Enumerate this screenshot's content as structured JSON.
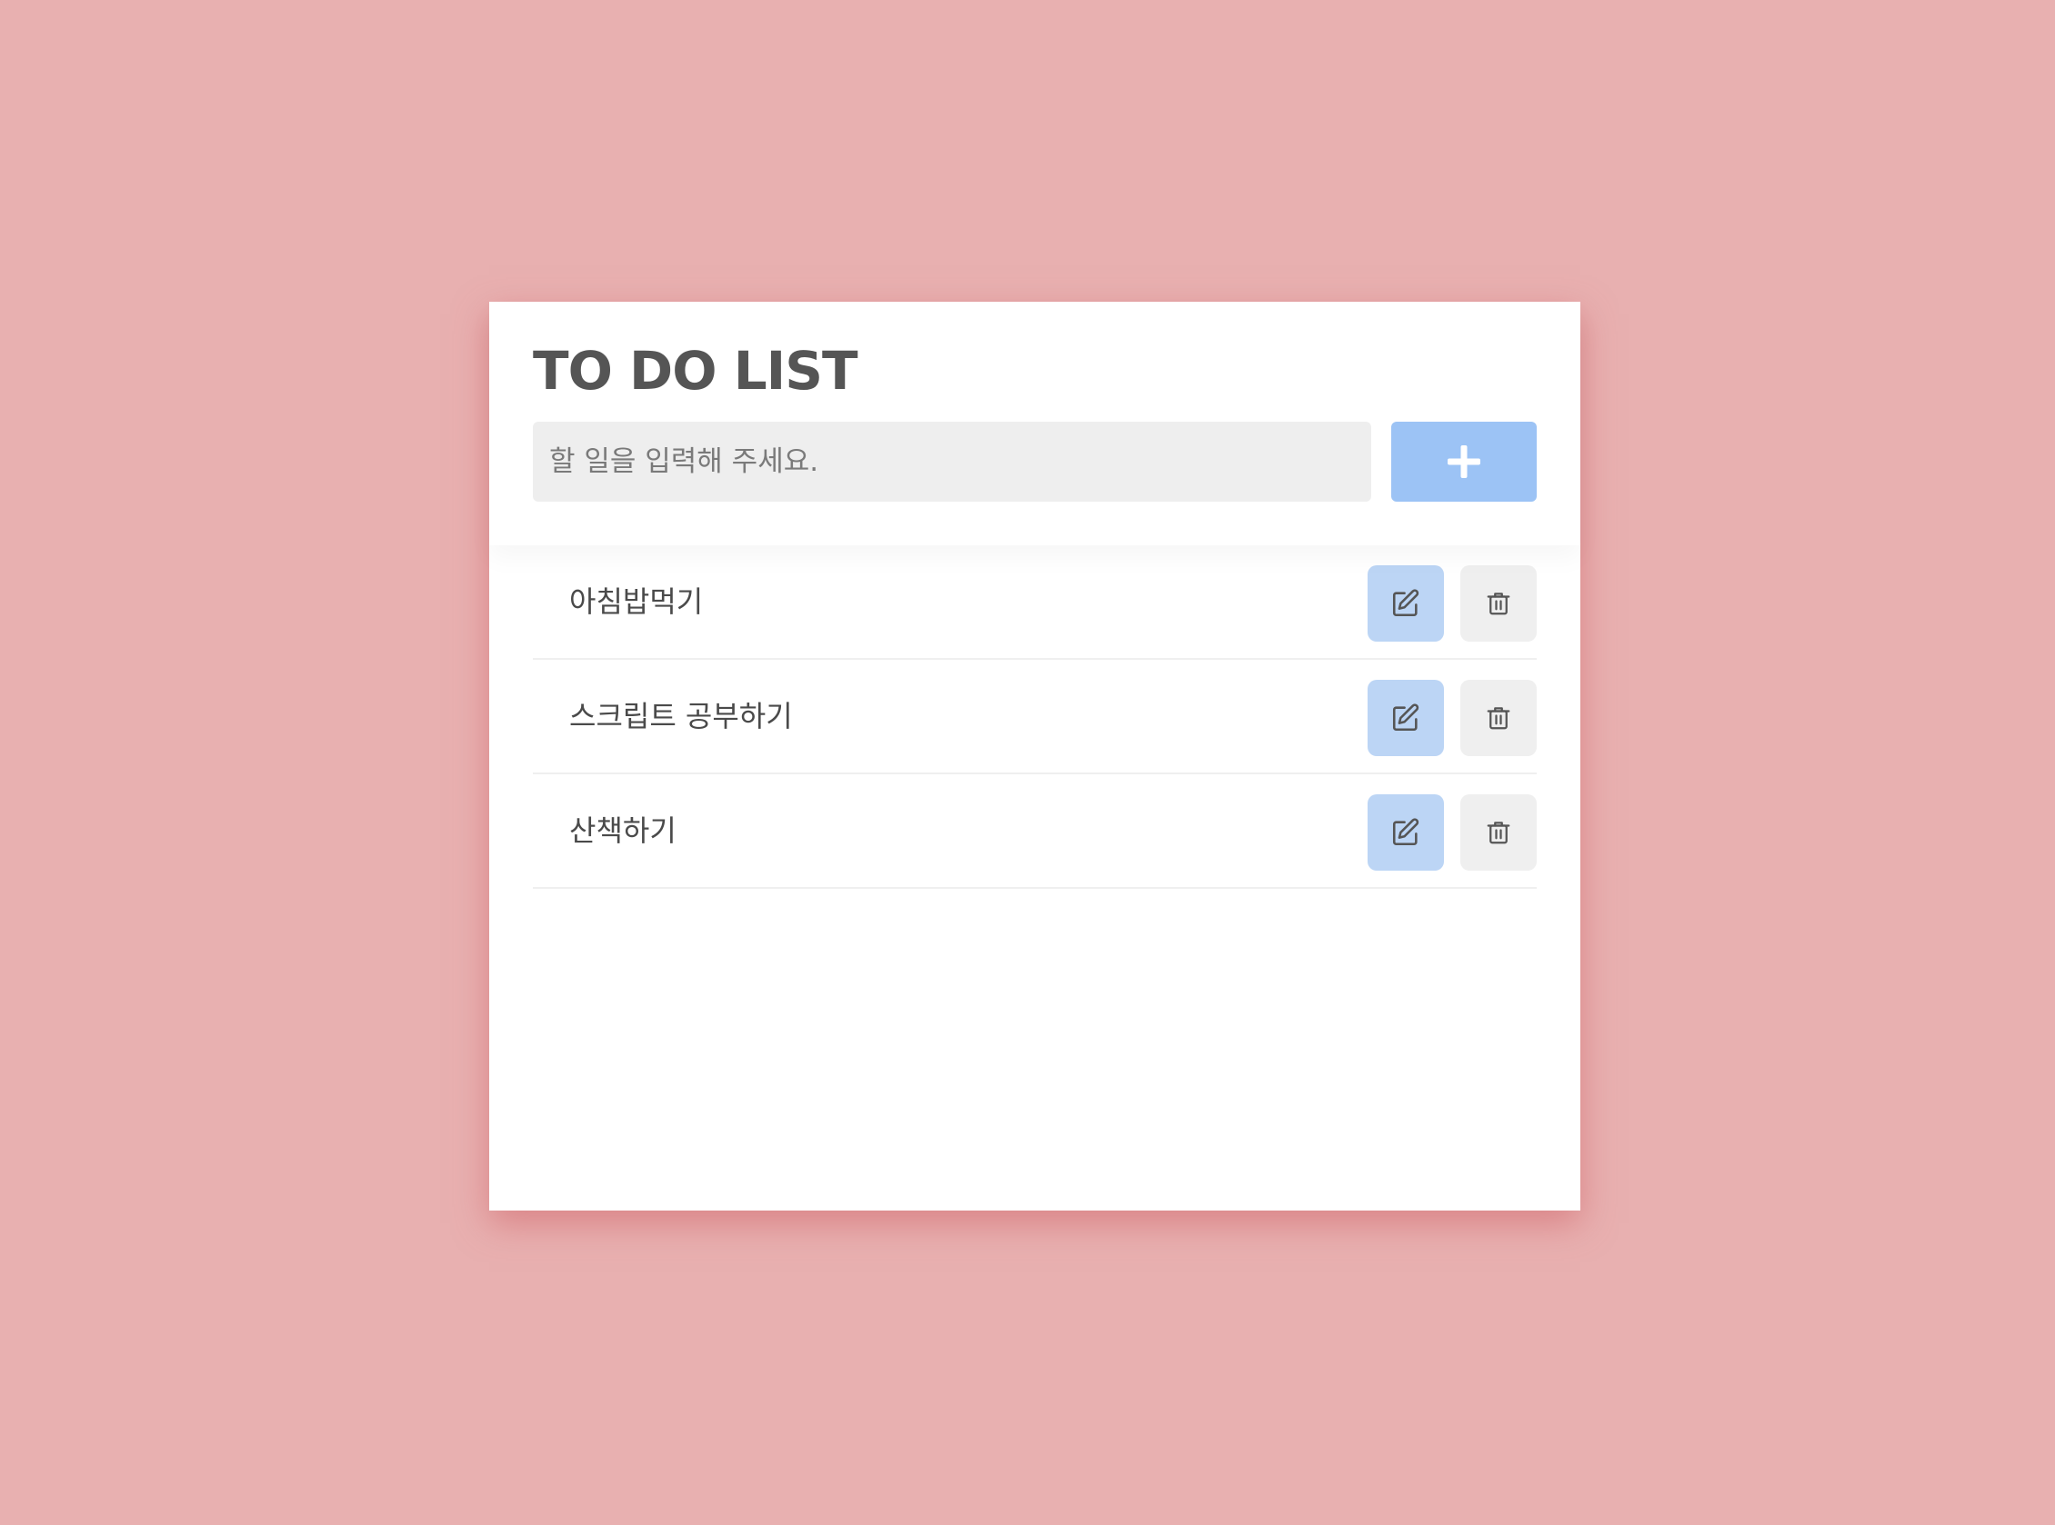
{
  "header": {
    "title": "TO DO LIST"
  },
  "input": {
    "placeholder": "할 일을 입력해 주세요.",
    "value": ""
  },
  "add_button": {
    "icon": "plus-icon"
  },
  "todos": [
    {
      "text": "아침밥먹기",
      "edit_icon": "edit-icon",
      "delete_icon": "trash-icon"
    },
    {
      "text": "스크립트 공부하기",
      "edit_icon": "edit-icon",
      "delete_icon": "trash-icon"
    },
    {
      "text": "산책하기",
      "edit_icon": "edit-icon",
      "delete_icon": "trash-icon"
    }
  ],
  "colors": {
    "background": "#e8b0b0",
    "card": "#ffffff",
    "title_text": "#555555",
    "input_background": "#eeeeee",
    "add_button": "#9cc3f5",
    "edit_button": "#bcd5f5",
    "delete_button": "#efefef",
    "item_text": "#4a4a4a"
  }
}
